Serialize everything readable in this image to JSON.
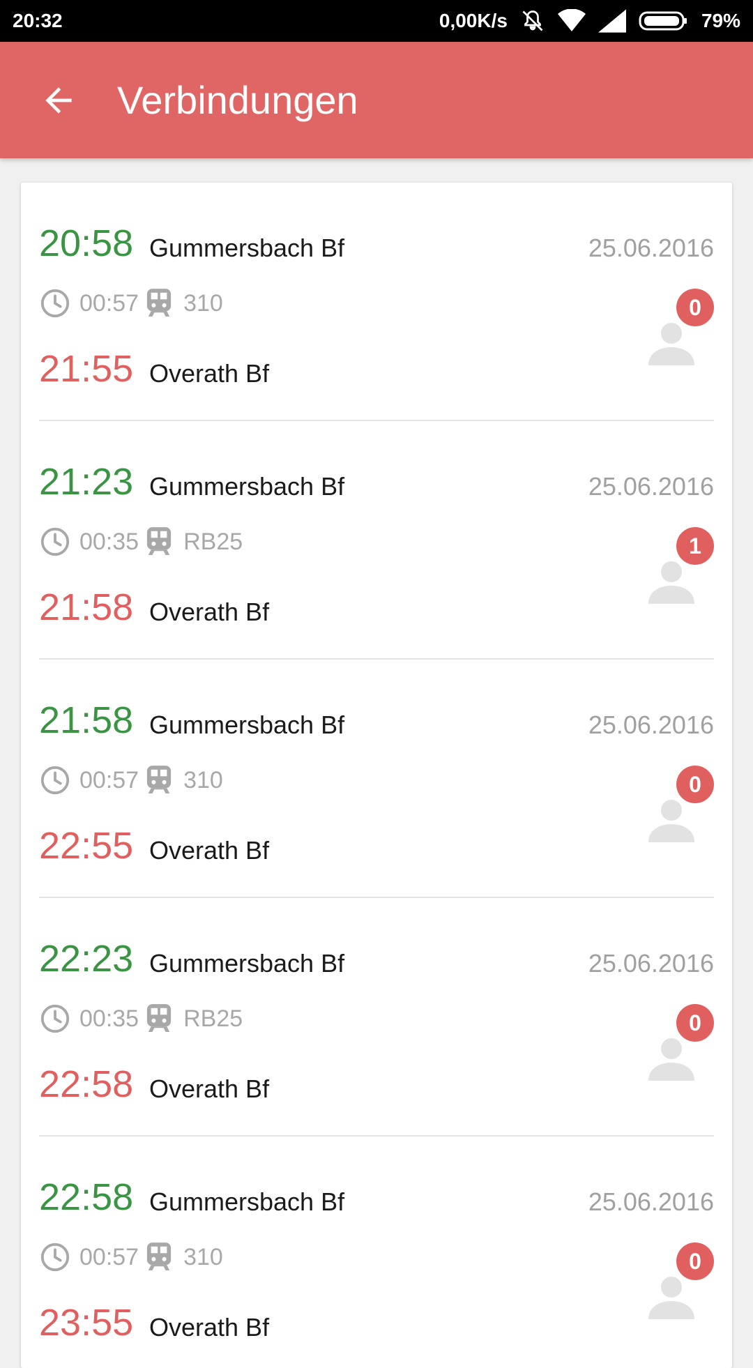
{
  "status_bar": {
    "time": "20:32",
    "network_speed": "0,00K/s",
    "battery": "79%",
    "icons": [
      "mute-vibrate-icon",
      "wifi-icon",
      "signal-icon",
      "battery-icon"
    ]
  },
  "app_bar": {
    "title": "Verbindungen",
    "back_icon": "arrow-back-icon",
    "color": "#e06666"
  },
  "colors": {
    "departure": "#3a9443",
    "arrival": "#e06060",
    "secondary": "#a0a0a0"
  },
  "connections": [
    {
      "dep_time": "20:58",
      "dep_station": "Gummersbach Bf",
      "date": "25.06.2016",
      "duration": "00:57",
      "line": "310",
      "arr_time": "21:55",
      "arr_station": "Overath Bf",
      "count": "0"
    },
    {
      "dep_time": "21:23",
      "dep_station": "Gummersbach Bf",
      "date": "25.06.2016",
      "duration": "00:35",
      "line": "RB25",
      "arr_time": "21:58",
      "arr_station": "Overath Bf",
      "count": "1"
    },
    {
      "dep_time": "21:58",
      "dep_station": "Gummersbach Bf",
      "date": "25.06.2016",
      "duration": "00:57",
      "line": "310",
      "arr_time": "22:55",
      "arr_station": "Overath Bf",
      "count": "0"
    },
    {
      "dep_time": "22:23",
      "dep_station": "Gummersbach Bf",
      "date": "25.06.2016",
      "duration": "00:35",
      "line": "RB25",
      "arr_time": "22:58",
      "arr_station": "Overath Bf",
      "count": "0"
    },
    {
      "dep_time": "22:58",
      "dep_station": "Gummersbach Bf",
      "date": "25.06.2016",
      "duration": "00:57",
      "line": "310",
      "arr_time": "23:55",
      "arr_station": "Overath Bf",
      "count": "0"
    }
  ]
}
